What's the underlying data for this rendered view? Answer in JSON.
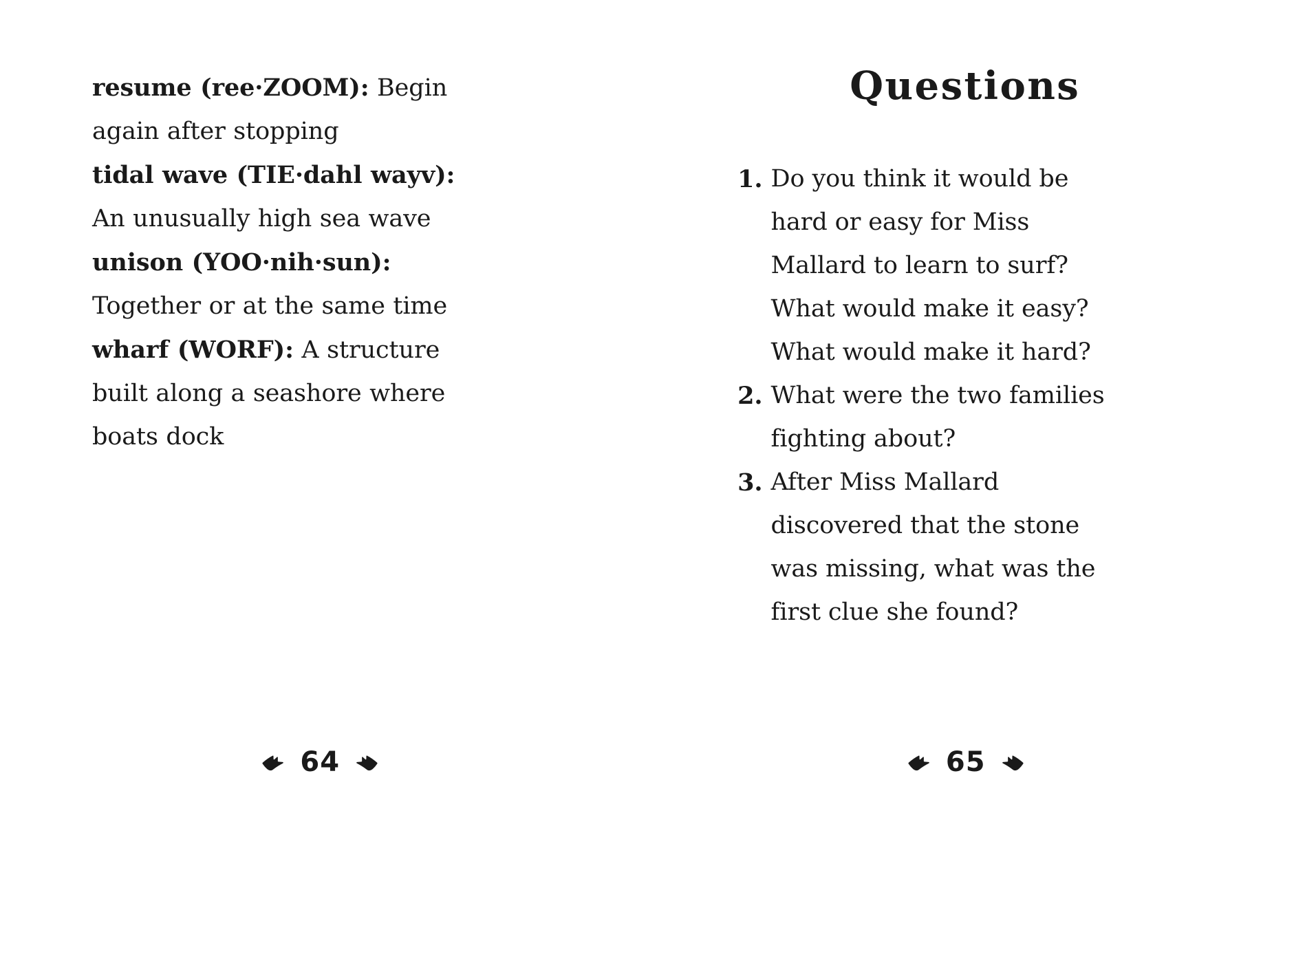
{
  "spread": {
    "left_page": {
      "folio": "64",
      "ornament_left": "duck-foot-left-icon",
      "ornament_right": "duck-foot-right-icon",
      "glossary": [
        {
          "term": "resume (ree·ZOOM):",
          "definition": " Begin again after stopping"
        },
        {
          "term": "tidal wave (TIE·dahl wayv):",
          "definition": " An unusually high sea wave"
        },
        {
          "term": "unison (YOO·nih·sun):",
          "definition": " Together or at the same time"
        },
        {
          "term": "wharf (WORF):",
          "definition": " A structure built along a seashore where boats dock"
        }
      ]
    },
    "right_page": {
      "folio": "65",
      "ornament_left": "duck-foot-left-icon",
      "ornament_right": "duck-foot-right-icon",
      "heading": "Questions",
      "questions": [
        {
          "number": "1.",
          "text": "Do you think it would be hard or easy for Miss Mallard to learn to surf? What would make it easy? What would make it hard?"
        },
        {
          "number": "2.",
          "text": "What were the two families fighting about?"
        },
        {
          "number": "3.",
          "text": "After Miss Mallard discovered that the stone was missing, what was the first clue she found?"
        }
      ]
    }
  },
  "colors": {
    "background": "#ffffff",
    "text": "#1a1a1a"
  }
}
